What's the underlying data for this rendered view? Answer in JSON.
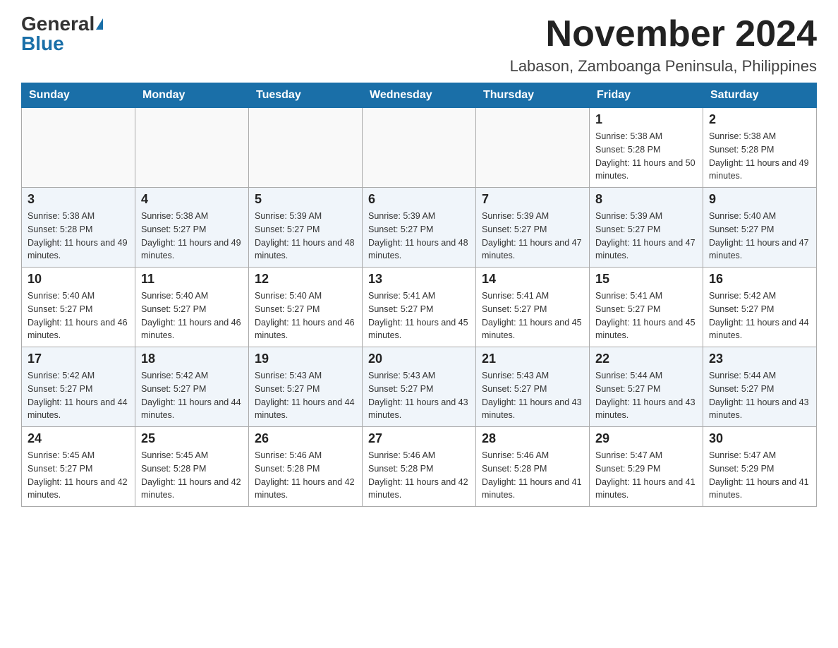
{
  "header": {
    "logo_general": "General",
    "logo_blue": "Blue",
    "month_title": "November 2024",
    "location": "Labason, Zamboanga Peninsula, Philippines"
  },
  "days_of_week": [
    "Sunday",
    "Monday",
    "Tuesday",
    "Wednesday",
    "Thursday",
    "Friday",
    "Saturday"
  ],
  "weeks": [
    [
      {
        "day": "",
        "sunrise": "",
        "sunset": "",
        "daylight": ""
      },
      {
        "day": "",
        "sunrise": "",
        "sunset": "",
        "daylight": ""
      },
      {
        "day": "",
        "sunrise": "",
        "sunset": "",
        "daylight": ""
      },
      {
        "day": "",
        "sunrise": "",
        "sunset": "",
        "daylight": ""
      },
      {
        "day": "",
        "sunrise": "",
        "sunset": "",
        "daylight": ""
      },
      {
        "day": "1",
        "sunrise": "Sunrise: 5:38 AM",
        "sunset": "Sunset: 5:28 PM",
        "daylight": "Daylight: 11 hours and 50 minutes."
      },
      {
        "day": "2",
        "sunrise": "Sunrise: 5:38 AM",
        "sunset": "Sunset: 5:28 PM",
        "daylight": "Daylight: 11 hours and 49 minutes."
      }
    ],
    [
      {
        "day": "3",
        "sunrise": "Sunrise: 5:38 AM",
        "sunset": "Sunset: 5:28 PM",
        "daylight": "Daylight: 11 hours and 49 minutes."
      },
      {
        "day": "4",
        "sunrise": "Sunrise: 5:38 AM",
        "sunset": "Sunset: 5:27 PM",
        "daylight": "Daylight: 11 hours and 49 minutes."
      },
      {
        "day": "5",
        "sunrise": "Sunrise: 5:39 AM",
        "sunset": "Sunset: 5:27 PM",
        "daylight": "Daylight: 11 hours and 48 minutes."
      },
      {
        "day": "6",
        "sunrise": "Sunrise: 5:39 AM",
        "sunset": "Sunset: 5:27 PM",
        "daylight": "Daylight: 11 hours and 48 minutes."
      },
      {
        "day": "7",
        "sunrise": "Sunrise: 5:39 AM",
        "sunset": "Sunset: 5:27 PM",
        "daylight": "Daylight: 11 hours and 47 minutes."
      },
      {
        "day": "8",
        "sunrise": "Sunrise: 5:39 AM",
        "sunset": "Sunset: 5:27 PM",
        "daylight": "Daylight: 11 hours and 47 minutes."
      },
      {
        "day": "9",
        "sunrise": "Sunrise: 5:40 AM",
        "sunset": "Sunset: 5:27 PM",
        "daylight": "Daylight: 11 hours and 47 minutes."
      }
    ],
    [
      {
        "day": "10",
        "sunrise": "Sunrise: 5:40 AM",
        "sunset": "Sunset: 5:27 PM",
        "daylight": "Daylight: 11 hours and 46 minutes."
      },
      {
        "day": "11",
        "sunrise": "Sunrise: 5:40 AM",
        "sunset": "Sunset: 5:27 PM",
        "daylight": "Daylight: 11 hours and 46 minutes."
      },
      {
        "day": "12",
        "sunrise": "Sunrise: 5:40 AM",
        "sunset": "Sunset: 5:27 PM",
        "daylight": "Daylight: 11 hours and 46 minutes."
      },
      {
        "day": "13",
        "sunrise": "Sunrise: 5:41 AM",
        "sunset": "Sunset: 5:27 PM",
        "daylight": "Daylight: 11 hours and 45 minutes."
      },
      {
        "day": "14",
        "sunrise": "Sunrise: 5:41 AM",
        "sunset": "Sunset: 5:27 PM",
        "daylight": "Daylight: 11 hours and 45 minutes."
      },
      {
        "day": "15",
        "sunrise": "Sunrise: 5:41 AM",
        "sunset": "Sunset: 5:27 PM",
        "daylight": "Daylight: 11 hours and 45 minutes."
      },
      {
        "day": "16",
        "sunrise": "Sunrise: 5:42 AM",
        "sunset": "Sunset: 5:27 PM",
        "daylight": "Daylight: 11 hours and 44 minutes."
      }
    ],
    [
      {
        "day": "17",
        "sunrise": "Sunrise: 5:42 AM",
        "sunset": "Sunset: 5:27 PM",
        "daylight": "Daylight: 11 hours and 44 minutes."
      },
      {
        "day": "18",
        "sunrise": "Sunrise: 5:42 AM",
        "sunset": "Sunset: 5:27 PM",
        "daylight": "Daylight: 11 hours and 44 minutes."
      },
      {
        "day": "19",
        "sunrise": "Sunrise: 5:43 AM",
        "sunset": "Sunset: 5:27 PM",
        "daylight": "Daylight: 11 hours and 44 minutes."
      },
      {
        "day": "20",
        "sunrise": "Sunrise: 5:43 AM",
        "sunset": "Sunset: 5:27 PM",
        "daylight": "Daylight: 11 hours and 43 minutes."
      },
      {
        "day": "21",
        "sunrise": "Sunrise: 5:43 AM",
        "sunset": "Sunset: 5:27 PM",
        "daylight": "Daylight: 11 hours and 43 minutes."
      },
      {
        "day": "22",
        "sunrise": "Sunrise: 5:44 AM",
        "sunset": "Sunset: 5:27 PM",
        "daylight": "Daylight: 11 hours and 43 minutes."
      },
      {
        "day": "23",
        "sunrise": "Sunrise: 5:44 AM",
        "sunset": "Sunset: 5:27 PM",
        "daylight": "Daylight: 11 hours and 43 minutes."
      }
    ],
    [
      {
        "day": "24",
        "sunrise": "Sunrise: 5:45 AM",
        "sunset": "Sunset: 5:27 PM",
        "daylight": "Daylight: 11 hours and 42 minutes."
      },
      {
        "day": "25",
        "sunrise": "Sunrise: 5:45 AM",
        "sunset": "Sunset: 5:28 PM",
        "daylight": "Daylight: 11 hours and 42 minutes."
      },
      {
        "day": "26",
        "sunrise": "Sunrise: 5:46 AM",
        "sunset": "Sunset: 5:28 PM",
        "daylight": "Daylight: 11 hours and 42 minutes."
      },
      {
        "day": "27",
        "sunrise": "Sunrise: 5:46 AM",
        "sunset": "Sunset: 5:28 PM",
        "daylight": "Daylight: 11 hours and 42 minutes."
      },
      {
        "day": "28",
        "sunrise": "Sunrise: 5:46 AM",
        "sunset": "Sunset: 5:28 PM",
        "daylight": "Daylight: 11 hours and 41 minutes."
      },
      {
        "day": "29",
        "sunrise": "Sunrise: 5:47 AM",
        "sunset": "Sunset: 5:29 PM",
        "daylight": "Daylight: 11 hours and 41 minutes."
      },
      {
        "day": "30",
        "sunrise": "Sunrise: 5:47 AM",
        "sunset": "Sunset: 5:29 PM",
        "daylight": "Daylight: 11 hours and 41 minutes."
      }
    ]
  ]
}
